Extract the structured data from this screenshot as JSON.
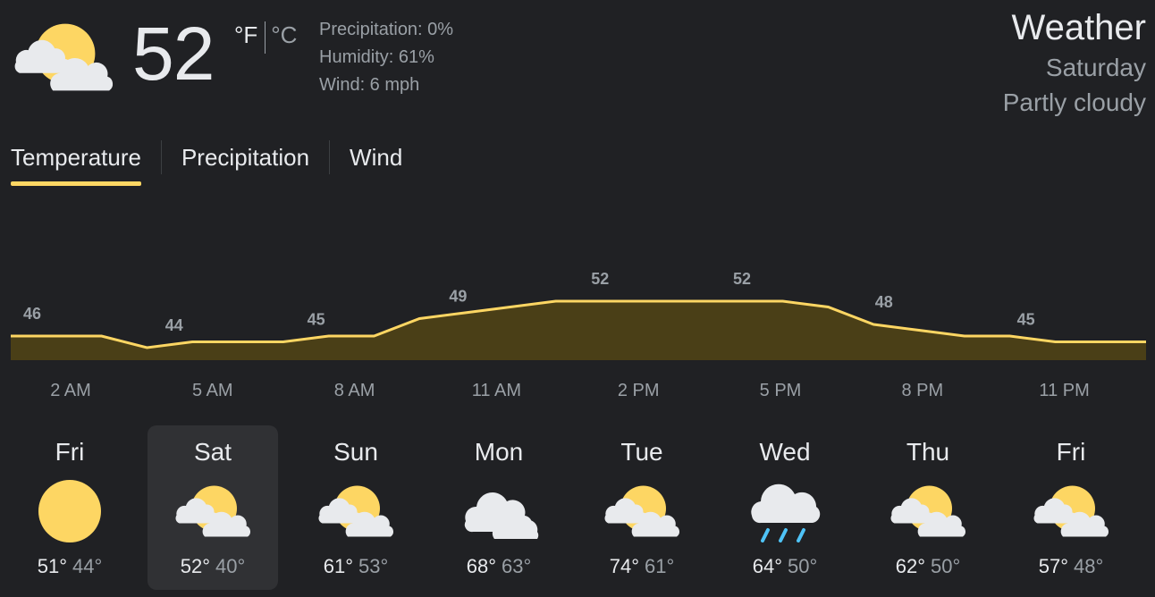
{
  "current": {
    "icon": "partly-cloudy-icon",
    "temperature": "52",
    "unit_f": "°F",
    "unit_c": "°C",
    "precipitation": "Precipitation: 0%",
    "humidity": "Humidity: 61%",
    "wind": "Wind: 6 mph"
  },
  "header": {
    "title": "Weather",
    "day": "Saturday",
    "condition": "Partly cloudy"
  },
  "tabs": [
    {
      "label": "Temperature",
      "active": true
    },
    {
      "label": "Precipitation",
      "active": false
    },
    {
      "label": "Wind",
      "active": false
    }
  ],
  "chart_data": {
    "type": "area",
    "x": [
      "2 AM",
      "5 AM",
      "8 AM",
      "11 AM",
      "2 PM",
      "5 PM",
      "8 PM",
      "11 PM"
    ],
    "values": [
      46,
      44,
      45,
      49,
      52,
      52,
      48,
      45
    ],
    "labeled_points": [
      46,
      44,
      45,
      49,
      52,
      52,
      48,
      45
    ],
    "hourly_values": [
      46,
      46,
      46,
      44,
      45,
      45,
      45,
      46,
      46,
      49,
      50,
      51,
      52,
      52,
      52,
      52,
      52,
      52,
      51,
      48,
      47,
      46,
      46,
      45,
      45,
      45
    ],
    "line_color": "#fdd663",
    "fill_color": "#4a3f17"
  },
  "forecast": [
    {
      "day": "Fri",
      "icon": "sunny-icon",
      "high": "51°",
      "low": "44°",
      "selected": false
    },
    {
      "day": "Sat",
      "icon": "partly-cloudy-icon",
      "high": "52°",
      "low": "40°",
      "selected": true
    },
    {
      "day": "Sun",
      "icon": "partly-cloudy-icon",
      "high": "61°",
      "low": "53°",
      "selected": false
    },
    {
      "day": "Mon",
      "icon": "cloudy-icon",
      "high": "68°",
      "low": "63°",
      "selected": false
    },
    {
      "day": "Tue",
      "icon": "partly-cloudy-icon",
      "high": "74°",
      "low": "61°",
      "selected": false
    },
    {
      "day": "Wed",
      "icon": "rain-icon",
      "high": "64°",
      "low": "50°",
      "selected": false
    },
    {
      "day": "Thu",
      "icon": "partly-cloudy-icon",
      "high": "62°",
      "low": "50°",
      "selected": false
    },
    {
      "day": "Fri",
      "icon": "partly-cloudy-icon",
      "high": "57°",
      "low": "48°",
      "selected": false
    }
  ],
  "colors": {
    "background": "#202124",
    "accent": "#fdd663",
    "text_primary": "#e8eaed",
    "text_secondary": "#9aa0a6"
  }
}
